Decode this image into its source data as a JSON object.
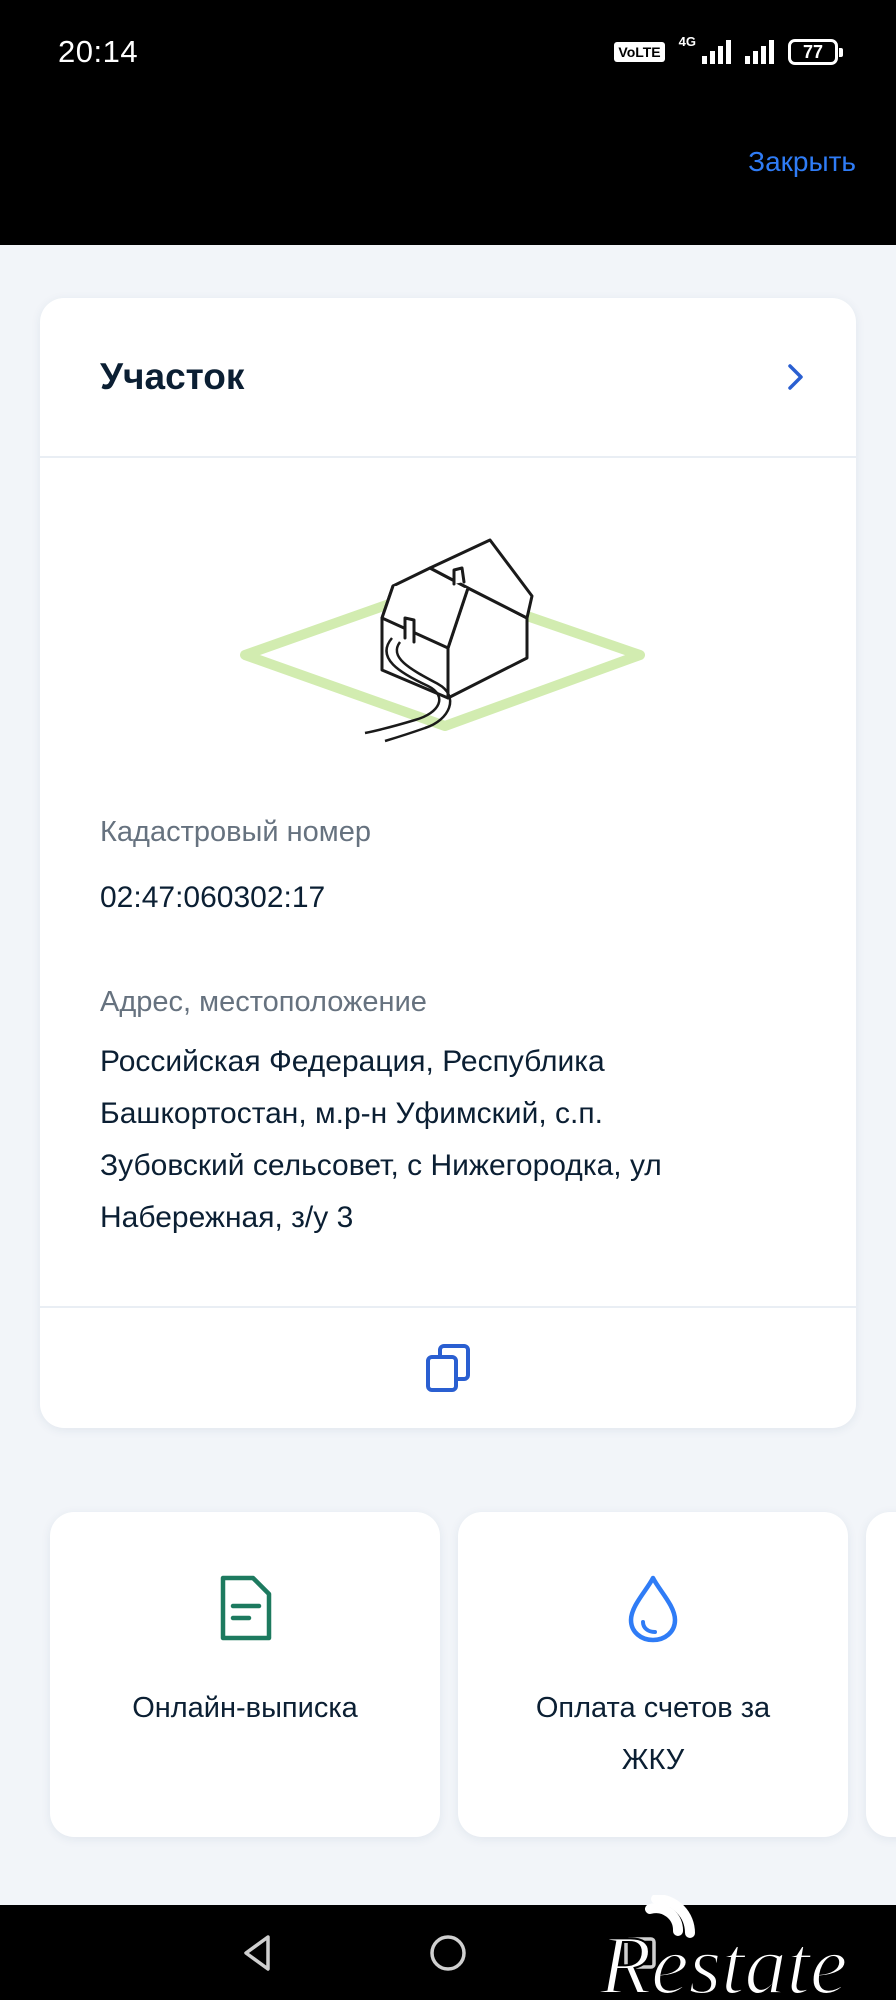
{
  "status_bar": {
    "time": "20:14",
    "volte": "VoLTE",
    "network": "4G",
    "battery": "77"
  },
  "header": {
    "close_label": "Закрыть",
    "close_color": "#2f7cf6"
  },
  "card": {
    "title": "Участок",
    "title_icon": "chevron-right-icon",
    "illustration": "house-on-plot-icon",
    "cadastral_label": "Кадастровый номер",
    "cadastral_value": "02:47:060302:17",
    "address_label": "Адрес, местоположение",
    "address_lines": [
      "Российская Федерация, Республика",
      "Башкортостан, м.р-н Уфимский, с.п.",
      "Зубовский сельсовет, с Нижегородка, ул",
      "Набережная, з/у 3"
    ],
    "footer_icon": "copy-icon"
  },
  "services": [
    {
      "label": "Онлайн-выписка",
      "icon": "document-icon",
      "icon_color": "#1d7a5f"
    },
    {
      "label_lines": [
        "Оплата счетов за",
        "ЖКУ"
      ],
      "icon": "water-drop-icon",
      "icon_color": "#2f7cf6"
    }
  ],
  "navigation": {
    "back": "back-triangle-icon",
    "home": "home-circle-icon",
    "recents": "recents-square-icon"
  },
  "watermark": {
    "text": "Restate"
  }
}
